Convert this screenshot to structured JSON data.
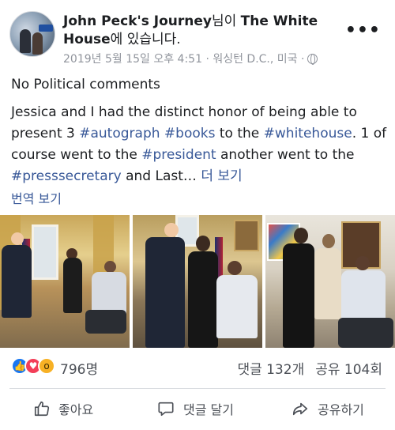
{
  "post": {
    "author_name": "John Peck's Journey",
    "author_mid": "님이 ",
    "location_name": "The White House",
    "location_suffix": "에 있습니다.",
    "timestamp": "2019년 5월 15일 오후 4:51 · 워싱턴 D.C., 미국 ·",
    "title": "No Political comments",
    "body": {
      "t1": "Jessica and I had the distinct honor of being able to present 3 ",
      "tag1": "#autograph",
      "t2": " ",
      "tag2": "#books",
      "t3": " to the ",
      "tag3": "#whitehouse",
      "t4": ". 1 of course went to the ",
      "tag4": "#president",
      "t5": " another went to the ",
      "tag5": "#presssecretary",
      "t6": " and Last… ",
      "see_more": "더 보기"
    },
    "translate": "번역 보기"
  },
  "stats": {
    "reaction_count": "796명",
    "comments": "댓글 132개",
    "shares": "공유 104회"
  },
  "actions": {
    "like": "좋아요",
    "comment": "댓글 달기",
    "share": "공유하기"
  },
  "icons": {
    "more": "more-options-icon",
    "globe": "globe-icon",
    "like": "thumbs-up-icon",
    "comment": "comment-bubble-icon",
    "share": "share-arrow-icon"
  },
  "colors": {
    "link": "#385898",
    "meta": "#90949c",
    "like_reaction": "#1877f2",
    "love_reaction": "#f33e58",
    "wow_reaction": "#f7b125"
  }
}
